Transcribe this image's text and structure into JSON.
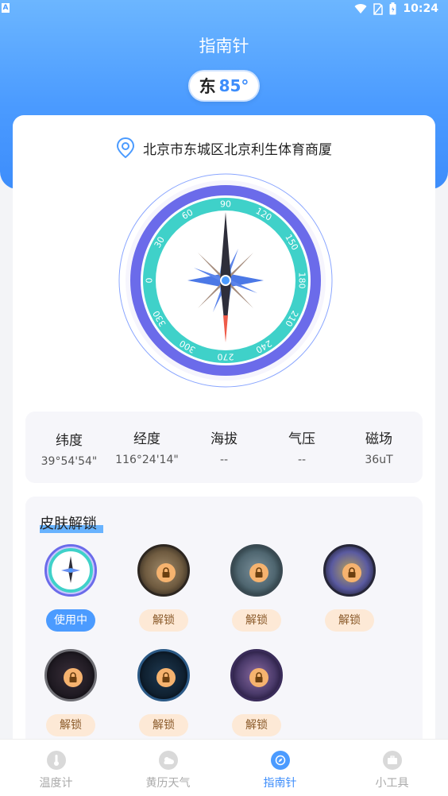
{
  "status_bar": {
    "indicator": "A",
    "time": "10:24"
  },
  "page_title": "指南针",
  "heading": {
    "direction": "东",
    "degrees": "85°"
  },
  "location": {
    "address": "北京市东城区北京利生体育商厦"
  },
  "compass": {
    "dial_labels": [
      "0",
      "30",
      "60",
      "90",
      "120",
      "150",
      "180",
      "210",
      "240",
      "270",
      "300",
      "330"
    ],
    "needle_heading_deg": 85
  },
  "stats": [
    {
      "label": "纬度",
      "value": "39°54'54\""
    },
    {
      "label": "经度",
      "value": "116°24'14\""
    },
    {
      "label": "海拔",
      "value": "--"
    },
    {
      "label": "气压",
      "value": "--"
    },
    {
      "label": "磁场",
      "value": "36uT"
    }
  ],
  "skins": {
    "title": "皮肤解锁",
    "items": [
      {
        "button": "使用中",
        "state": "in-use"
      },
      {
        "button": "解锁",
        "state": "locked"
      },
      {
        "button": "解锁",
        "state": "locked"
      },
      {
        "button": "解锁",
        "state": "locked"
      },
      {
        "button": "解锁",
        "state": "locked"
      },
      {
        "button": "解锁",
        "state": "locked"
      },
      {
        "button": "解锁",
        "state": "locked"
      }
    ]
  },
  "tabs": [
    {
      "label": "温度计",
      "icon": "thermometer-icon",
      "active": false
    },
    {
      "label": "黄历天气",
      "icon": "weather-icon",
      "active": false
    },
    {
      "label": "指南针",
      "icon": "compass-icon",
      "active": true
    },
    {
      "label": "小工具",
      "icon": "toolbox-icon",
      "active": false
    }
  ],
  "colors": {
    "accent": "#3d8dfb",
    "ring_teal": "#3fd1c9",
    "ring_purple": "#6b6bea",
    "unlock_bg": "#fde9d6"
  }
}
